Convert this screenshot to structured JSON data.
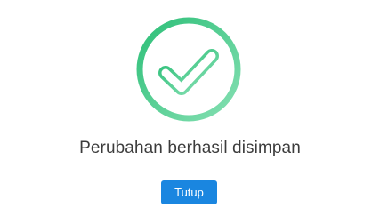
{
  "dialog": {
    "icon": "success-check-icon",
    "message": "Perubahan berhasil disimpan",
    "close_label": "Tutup"
  },
  "colors": {
    "success_gradient_start": "#2dbf78",
    "success_gradient_end": "#86e0b3",
    "button_bg": "#1a86e0",
    "message_text": "#3c3c3c"
  }
}
